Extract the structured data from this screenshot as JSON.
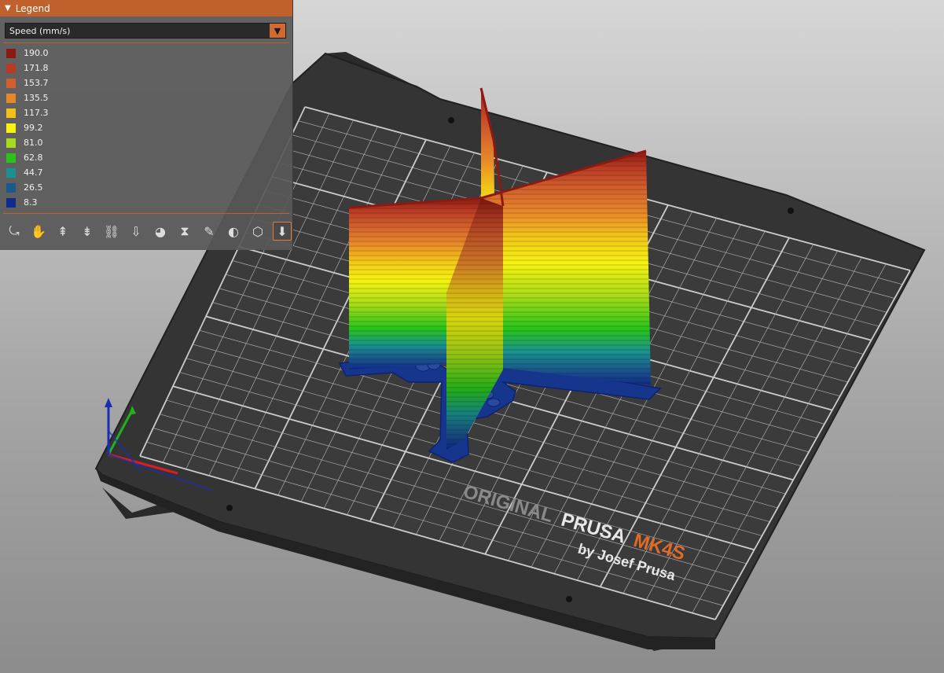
{
  "legend": {
    "title": "Legend",
    "view_type": "Speed (mm/s)",
    "entries": [
      {
        "label": "190.0",
        "color": "#8b1a12"
      },
      {
        "label": "171.8",
        "color": "#b83a24"
      },
      {
        "label": "153.7",
        "color": "#d25f2c"
      },
      {
        "label": "135.5",
        "color": "#e8862a"
      },
      {
        "label": "117.3",
        "color": "#f2c21a"
      },
      {
        "label": "99.2",
        "color": "#f6f312"
      },
      {
        "label": "81.0",
        "color": "#a8dc18"
      },
      {
        "label": "62.8",
        "color": "#28c41a"
      },
      {
        "label": "44.7",
        "color": "#1a9090"
      },
      {
        "label": "26.5",
        "color": "#1a5a8a"
      },
      {
        "label": "8.3",
        "color": "#102a8a"
      }
    ]
  },
  "toolbar": {
    "items": [
      {
        "name": "travel-icon",
        "glyph": "⤿"
      },
      {
        "name": "wipe-icon",
        "glyph": "✋"
      },
      {
        "name": "retractions-icon",
        "glyph": "⇞"
      },
      {
        "name": "deretractions-icon",
        "glyph": "⇟"
      },
      {
        "name": "seams-icon",
        "glyph": "⛓"
      },
      {
        "name": "tool-changes-icon",
        "glyph": "⇩"
      },
      {
        "name": "color-changes-icon",
        "glyph": "◕"
      },
      {
        "name": "pause-icon",
        "glyph": "⧗"
      },
      {
        "name": "custom-gcode-icon",
        "glyph": "✎"
      },
      {
        "name": "center-of-gravity-icon",
        "glyph": "◐"
      },
      {
        "name": "shells-icon",
        "glyph": "⬡"
      },
      {
        "name": "tool-marker-icon",
        "glyph": "⬇"
      }
    ]
  },
  "bed": {
    "brand_line1_grey": "ORIGINAL",
    "brand_line1_white": "PRUSA",
    "brand_line1_orange": "MK4S",
    "brand_line2": "by Josef Prusa"
  }
}
